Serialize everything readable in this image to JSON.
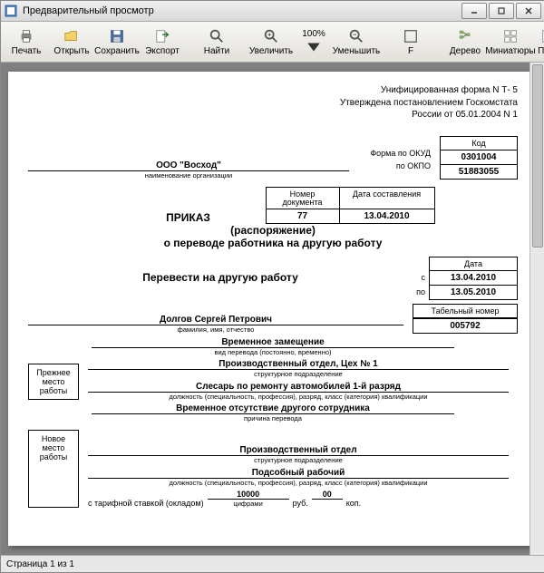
{
  "window": {
    "title": "Предварительный просмотр"
  },
  "toolbar": {
    "print": "Печать",
    "open": "Открыть",
    "save": "Сохранить",
    "export": "Экспорт",
    "find": "Найти",
    "zoom_in": "Увеличить",
    "zoom_value": "100%",
    "zoom_out": "Уменьшить",
    "f_button": "F",
    "tree": "Дерево",
    "thumbs": "Миниатюры",
    "fields": "Поля"
  },
  "doc": {
    "form_line1": "Унифицированная форма N Т- 5",
    "form_line2": "Утверждена постановлением Госкомстата",
    "form_line3": "России от 05.01.2004 N 1",
    "code_label": "Код",
    "okud_label": "Форма по ОКУД",
    "okud_value": "0301004",
    "okpo_label": "по ОКПО",
    "okpo_value": "51883055",
    "org_name": "ООО \"Восход\"",
    "org_sublabel": "наименование организации",
    "docnum_label1": "Номер",
    "docnum_label2": "документа",
    "docnum_value": "77",
    "docdate_label": "Дата составления",
    "docdate_value": "13.04.2010",
    "title1": "ПРИКАЗ",
    "title2": "(распоряжение)",
    "title3": "о переводе работника на другую работу",
    "transfer_heading": "Перевести на другую работу",
    "date_label": "Дата",
    "date_from_label": "с",
    "date_from_value": "13.04.2010",
    "date_to_label": "по",
    "date_to_value": "13.05.2010",
    "tabnum_label": "Табельный номер",
    "tabnum_value": "005792",
    "fio_value": "Долгов Сергей Петрович",
    "fio_sublabel": "фамилия, имя, отчество",
    "transfer_type_value": "Временное замещение",
    "transfer_type_sublabel": "вид перевода (постоянно, временно)",
    "prev_block_label1": "Прежнее",
    "prev_block_label2": "место",
    "prev_block_label3": "работы",
    "prev_dept_value": "Производственный отдел, Цех № 1",
    "prev_dept_sublabel": "структурное подразделение",
    "prev_job_value": "Слесарь по ремонту автомобилей 1-й разряд",
    "prev_job_sublabel": "должность (специальность, профессия), разряд, класс (категория) квалификации",
    "reason_value": "Временное отсутствие другого сотрудника",
    "reason_sublabel": "причина перевода",
    "new_block_label1": "Новое",
    "new_block_label2": "место",
    "new_block_label3": "работы",
    "new_dept_value": "Производственный отдел",
    "new_dept_sublabel": "структурное подразделение",
    "new_job_value": "Подсобный рабочий",
    "new_job_sublabel": "должность (специальность, профессия), разряд, класс (категория) квалификации",
    "salary_prefix": "с тарифной ставкой (окладом)",
    "salary_value": "10000",
    "salary_rub": "руб.",
    "salary_kop_value": "00",
    "salary_kop": "коп.",
    "salary_sublabel": "цифрами"
  },
  "status": {
    "page": "Страница 1 из 1"
  }
}
